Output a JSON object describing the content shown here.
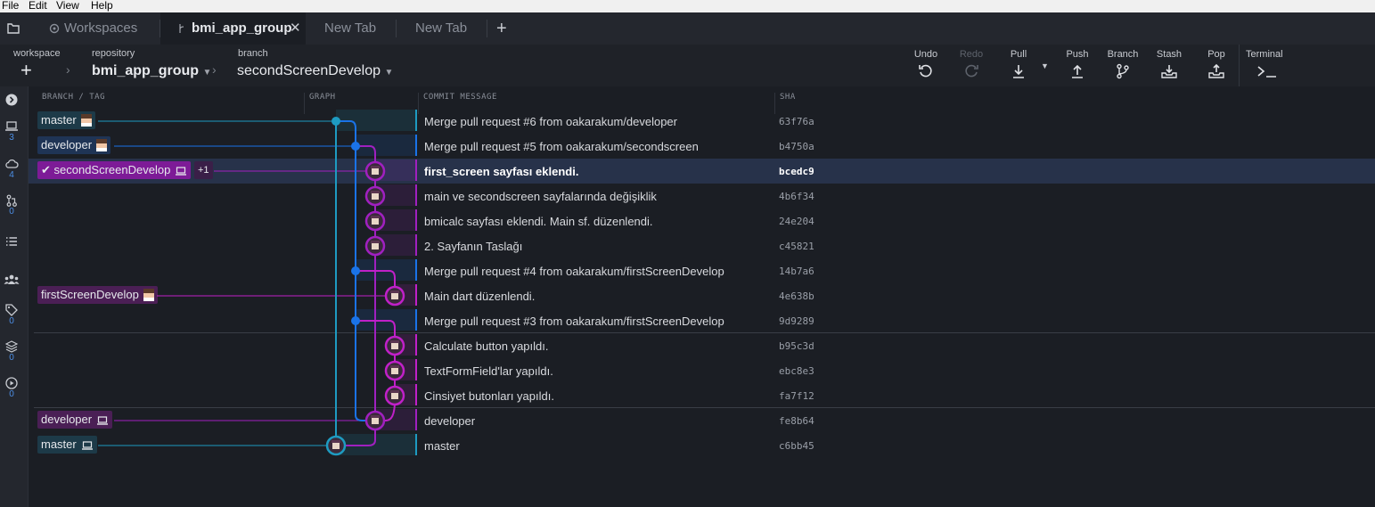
{
  "menu": [
    "File",
    "Edit",
    "View",
    "Help"
  ],
  "tabs": {
    "workspaces": "Workspaces",
    "active": "bmi_app_group",
    "new1": "New Tab",
    "new2": "New Tab",
    "add": "+"
  },
  "toolbar": {
    "workspace_label": "workspace",
    "workspace_add": "+",
    "repo_label": "repository",
    "repo_value": "bmi_app_group",
    "branch_label": "branch",
    "branch_value": "secondScreenDevelop",
    "actions": {
      "undo": "Undo",
      "redo": "Redo",
      "pull": "Pull",
      "push": "Push",
      "branch": "Branch",
      "stash": "Stash",
      "pop": "Pop",
      "terminal": "Terminal"
    }
  },
  "sidebar": {
    "local_count": "3",
    "remote_count": "4",
    "pr_count": "0",
    "tags_count": "0",
    "submodule_count": "0",
    "actions_count": "0"
  },
  "columns": {
    "branch_tag": "BRANCH / TAG",
    "graph": "GRAPH",
    "commit_message": "COMMIT MESSAGE",
    "sha": "SHA"
  },
  "colors": {
    "lane_master": "#1e9bc1",
    "lane_developer": "#1a73e8",
    "lane_second": "#a020c0",
    "lane_first": "#c020c8"
  },
  "commits": [
    {
      "message": "Merge pull request #6 from oakarakum/developer",
      "sha": "63f76a"
    },
    {
      "message": "Merge pull request #5 from oakarakum/secondscreen",
      "sha": "b4750a"
    },
    {
      "message": "first_screen sayfası eklendi.",
      "sha": "bcedc9"
    },
    {
      "message": "main ve secondscreen sayfalarında değişiklik",
      "sha": "4b6f34"
    },
    {
      "message": "bmicalc sayfası eklendi. Main sf. düzenlendi.",
      "sha": "24e204"
    },
    {
      "message": "2. Sayfanın Taslağı",
      "sha": "c45821"
    },
    {
      "message": "Merge pull request #4 from oakarakum/firstScreenDevelop",
      "sha": "14b7a6"
    },
    {
      "message": "Main dart düzenlendi.",
      "sha": "4e638b"
    },
    {
      "message": "Merge pull request #3 from oakarakum/firstScreenDevelop",
      "sha": "9d9289"
    },
    {
      "message": "Calculate button yapıldı.",
      "sha": "b95c3d"
    },
    {
      "message": "TextFormField'lar yapıldı.",
      "sha": "ebc8e3"
    },
    {
      "message": "Cinsiyet butonları yapıldı.",
      "sha": "fa7f12"
    },
    {
      "message": "developer",
      "sha": "fe8b64"
    },
    {
      "message": "master",
      "sha": "c6bb45"
    }
  ],
  "branches": {
    "master_remote": "master",
    "developer_remote": "developer",
    "second_local": "secondScreenDevelop",
    "second_extra": "+1",
    "first_remote": "firstScreenDevelop",
    "developer_local": "developer",
    "master_local": "master"
  }
}
